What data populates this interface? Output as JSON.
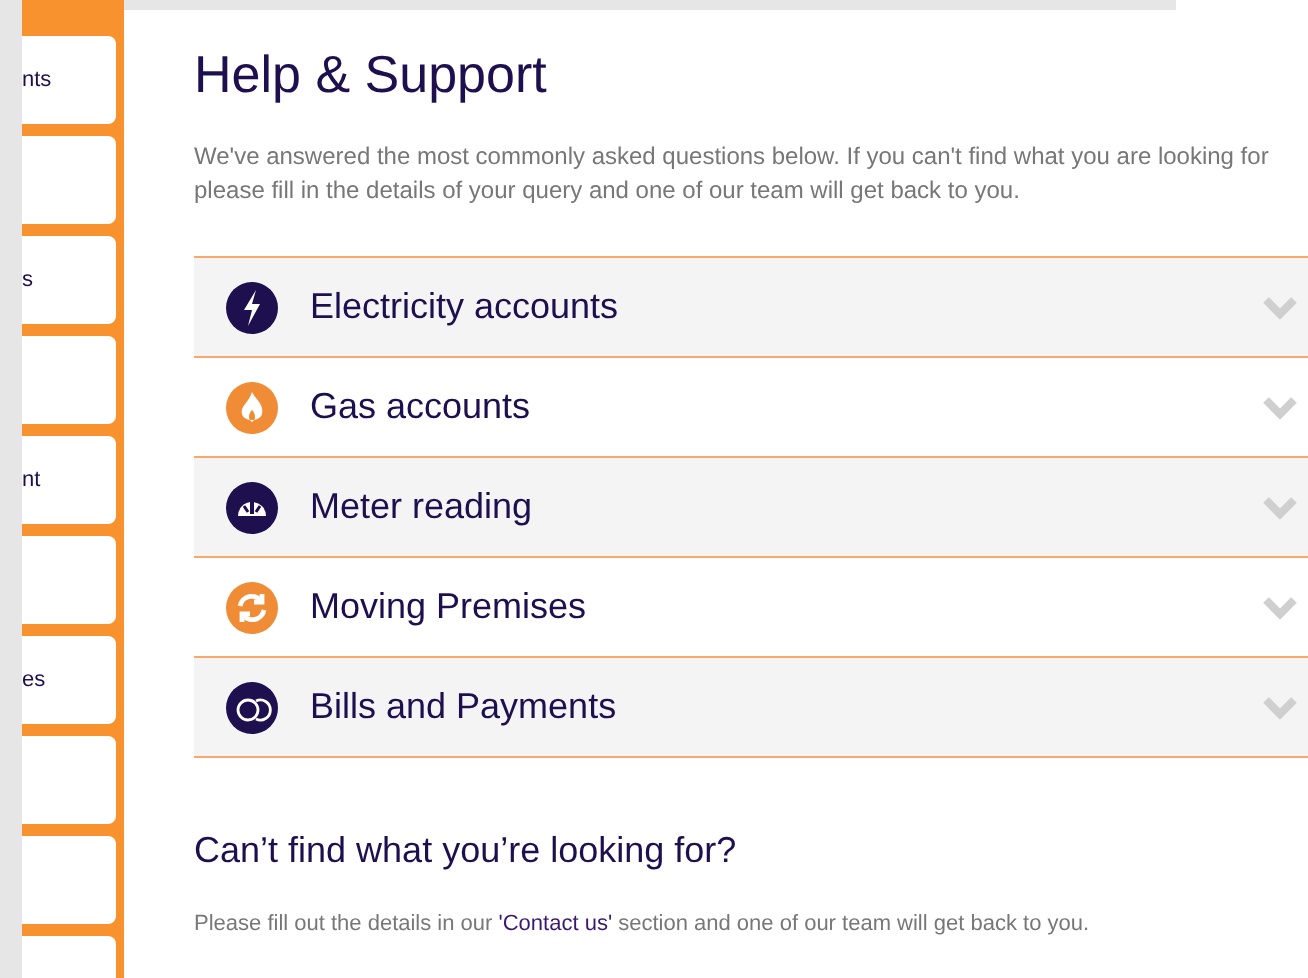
{
  "sidebar": {
    "items": [
      {
        "kind": "text",
        "label": "nts"
      },
      {
        "kind": "blank"
      },
      {
        "kind": "text",
        "label": "s"
      },
      {
        "kind": "blank"
      },
      {
        "kind": "text",
        "label": "nt"
      },
      {
        "kind": "blank"
      },
      {
        "kind": "text",
        "label": "es"
      },
      {
        "kind": "blank"
      },
      {
        "kind": "blank"
      },
      {
        "kind": "blank"
      }
    ]
  },
  "title": "Help & Support",
  "intro": "We've answered the most commonly asked questions below. If you can't find what you are looking for please fill in the details of your query and one of our team will get back to you.",
  "faq": [
    {
      "label": "Electricity accounts",
      "kind": "electricity",
      "expanded": false
    },
    {
      "label": "Gas accounts",
      "kind": "gas",
      "expanded": false
    },
    {
      "label": "Meter reading",
      "kind": "meter",
      "expanded": false
    },
    {
      "label": "Moving Premises",
      "kind": "moving",
      "expanded": false
    },
    {
      "label": "Bills and Payments",
      "kind": "bills",
      "expanded": false
    }
  ],
  "help": {
    "heading": "Can’t find what you’re looking for?",
    "text_before": "Please fill out the details in our ",
    "link": "'Contact us'",
    "text_after": " section and one of our team will get back to you."
  }
}
